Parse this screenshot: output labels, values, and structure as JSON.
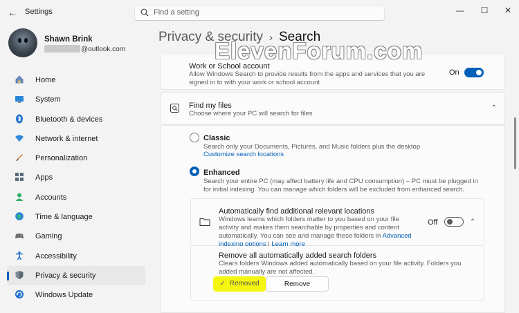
{
  "window": {
    "title": "Settings",
    "search_placeholder": "Find a setting",
    "controls": {
      "minimize": "—",
      "maximize": "☐",
      "close": "✕"
    }
  },
  "user": {
    "name": "Shawn Brink",
    "email": "@outlook.com"
  },
  "sidebar": {
    "items": [
      {
        "label": "Home",
        "icon": "home-icon"
      },
      {
        "label": "System",
        "icon": "system-icon"
      },
      {
        "label": "Bluetooth & devices",
        "icon": "bluetooth-icon"
      },
      {
        "label": "Network & internet",
        "icon": "network-icon"
      },
      {
        "label": "Personalization",
        "icon": "brush-icon"
      },
      {
        "label": "Apps",
        "icon": "apps-icon"
      },
      {
        "label": "Accounts",
        "icon": "accounts-icon"
      },
      {
        "label": "Time & language",
        "icon": "globe-icon"
      },
      {
        "label": "Gaming",
        "icon": "gaming-icon"
      },
      {
        "label": "Accessibility",
        "icon": "accessibility-icon"
      },
      {
        "label": "Privacy & security",
        "icon": "shield-icon"
      },
      {
        "label": "Windows Update",
        "icon": "update-icon"
      }
    ],
    "active_index": 10
  },
  "header": {
    "parent": "Privacy & security",
    "separator": "›",
    "current": "Search"
  },
  "watermark": "ElevenForum.com",
  "work_account": {
    "title": "Work or School account",
    "description": "Allow Windows Search to provide results from the apps and services that you are signed in to with your work or school account",
    "state_label": "On",
    "enabled": true
  },
  "find_files": {
    "title": "Find my files",
    "description": "Choose where your PC will search for files",
    "classic": {
      "label": "Classic",
      "description": "Search only your Documents, Pictures, and Music folders plus the desktop",
      "link": "Customize search locations",
      "selected": false
    },
    "enhanced": {
      "label": "Enhanced",
      "description": "Search your entire PC (may affect battery life and CPU consumption) – PC must be plugged in for initial indexing. You can manage which folders will be excluded from enhanced search.",
      "selected": true
    }
  },
  "auto_find": {
    "title": "Automatically find additional relevant locations",
    "description": "Windows learns which folders matter to you based on your file activity and makes them searchable by properties and content automatically. You can see and manage these folders in",
    "link1": "Advanced indexing options",
    "divider": "|",
    "link2": "Learn more",
    "state_label": "Off",
    "enabled": false
  },
  "remove_folders": {
    "title": "Remove all automatically added search folders",
    "description": "Clears folders Windows added automatically based on your file activity. Folders you added manually are not affected.",
    "removed_label": "Removed",
    "remove_label": "Remove",
    "highlight_color": "#f5f60f"
  },
  "colors": {
    "accent": "#005fb8"
  }
}
